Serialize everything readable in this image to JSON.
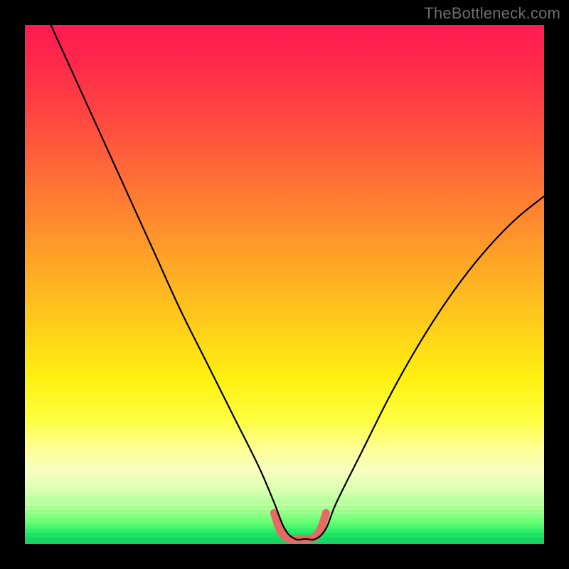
{
  "watermark": "TheBottleneck.com",
  "colors": {
    "frame": "#000000",
    "curve": "#000000",
    "marker": "#e66a64",
    "watermark_text": "#6d6d6d"
  },
  "chart_data": {
    "type": "line",
    "title": "",
    "xlabel": "",
    "ylabel": "",
    "x_range": [
      0,
      100
    ],
    "y_range": [
      0,
      100
    ],
    "notes": "V-shaped bottleneck curve over a vertical red→yellow→green gradient. Y encodes bottleneck severity (100 ≈ severe/red at top, 0 ≈ none/green at bottom). X is an unlabeled component-balance axis. Values are visual estimates.",
    "series": [
      {
        "name": "bottleneck_curve",
        "x": [
          5,
          10,
          15,
          20,
          25,
          30,
          35,
          40,
          45,
          48,
          50,
          52,
          54,
          56,
          58,
          60,
          65,
          70,
          75,
          80,
          85,
          90,
          95,
          100
        ],
        "y": [
          100,
          89,
          78,
          67,
          56,
          45,
          35,
          25,
          15,
          8,
          3,
          1,
          1,
          1,
          3,
          8,
          18,
          28,
          37,
          45,
          52,
          58,
          63,
          67
        ]
      },
      {
        "name": "optimal_marker",
        "x": [
          48,
          49,
          50,
          51,
          52,
          53,
          54,
          55,
          56,
          57,
          58
        ],
        "y": [
          6,
          3,
          1.5,
          1,
          1,
          1,
          1,
          1,
          1.5,
          3,
          6
        ]
      }
    ]
  }
}
